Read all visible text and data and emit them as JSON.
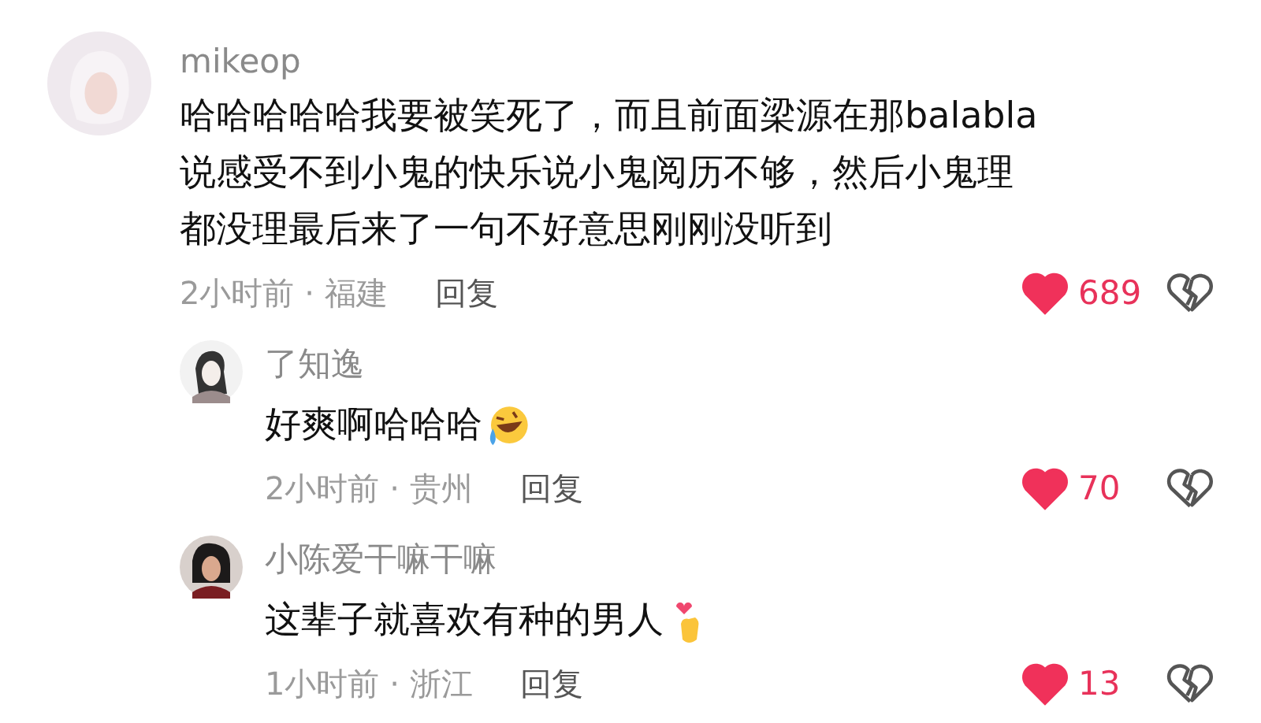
{
  "comments": [
    {
      "user": "mikeop",
      "text_lines": [
        "哈哈哈哈哈我要被笑死了，而且前面梁源在那balabla",
        "说感受不到小鬼的快乐说小鬼阅历不够，然后小鬼理",
        "都没理最后来了一句不好意思刚刚没听到"
      ],
      "meta": "2小时前 · 福建",
      "reply": "回复",
      "likes": "689",
      "liked": true,
      "replies": [
        {
          "user": "了知逸",
          "text": "好爽啊哈哈哈",
          "kind": "laugh",
          "meta": "2小时前 · 贵州",
          "reply": "回复",
          "likes": "70",
          "liked": true
        },
        {
          "user": "小陈爱干嘛干嘛",
          "text": "这辈子就喜欢有种的男人",
          "kind": "heart",
          "meta": "1小时前 · 浙江",
          "reply": "回复",
          "likes": "13",
          "liked": true
        }
      ]
    }
  ]
}
